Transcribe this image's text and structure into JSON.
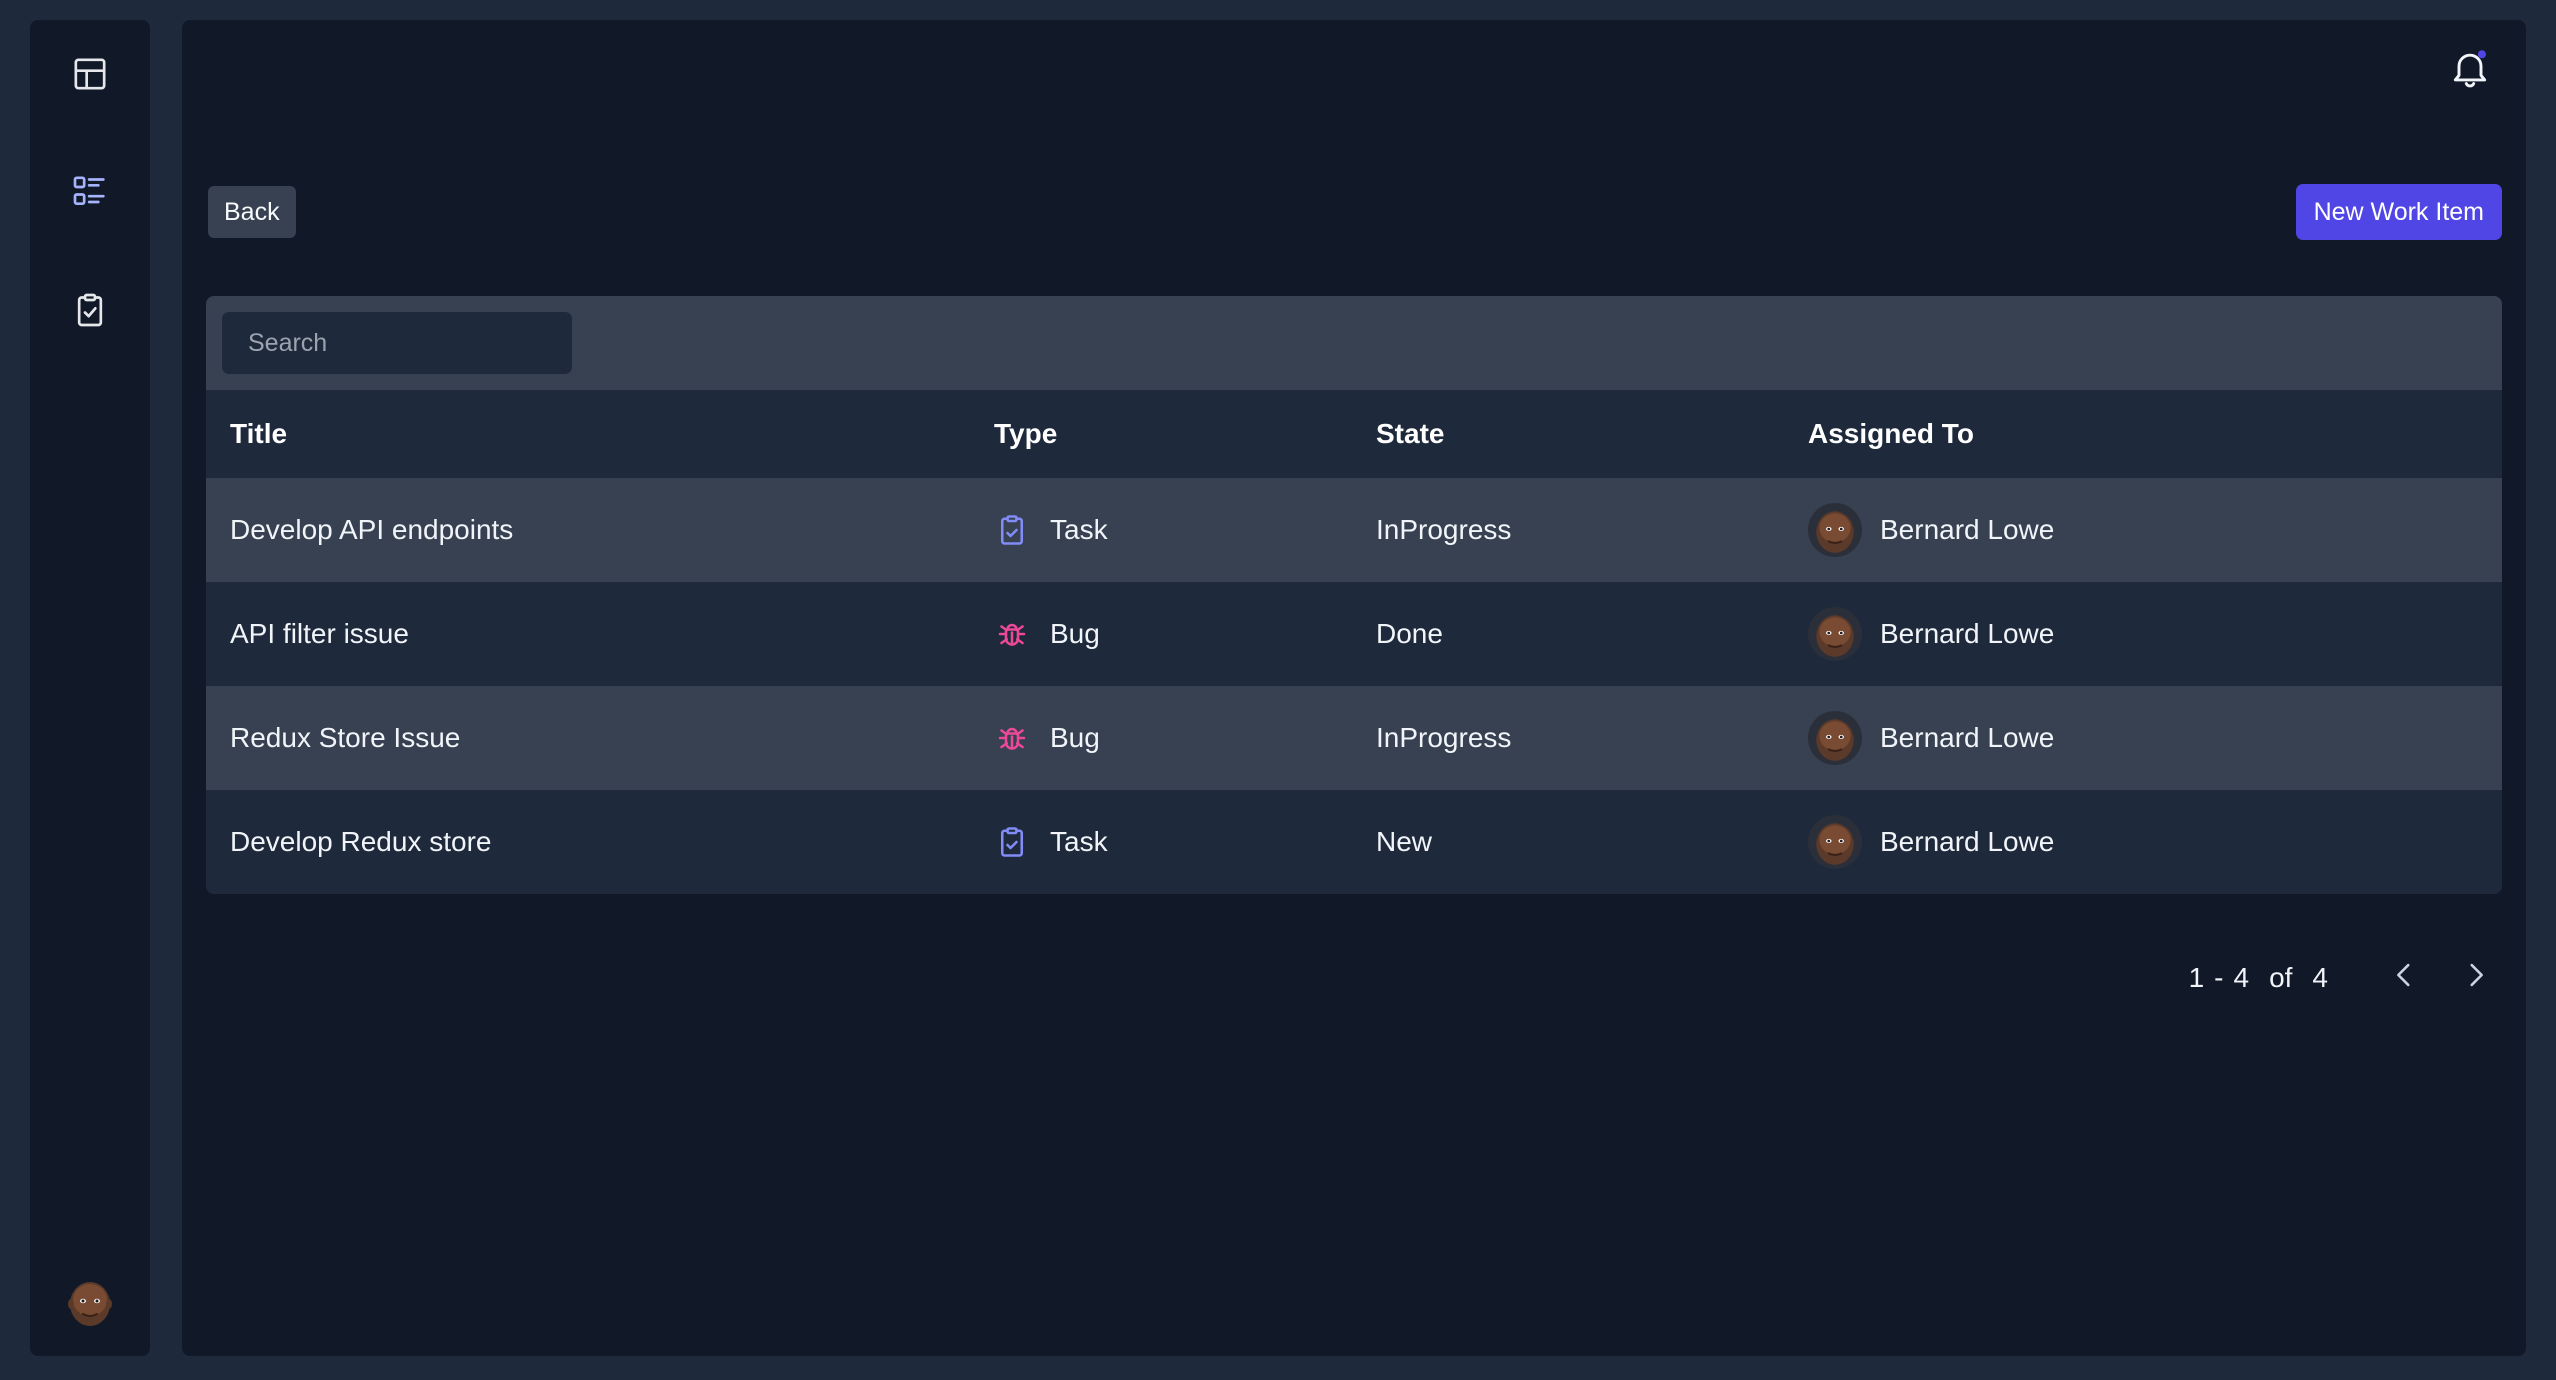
{
  "toolbar": {
    "back_label": "Back",
    "new_item_label": "New Work Item"
  },
  "search": {
    "placeholder": "Search",
    "value": ""
  },
  "table": {
    "columns": [
      "Title",
      "Type",
      "State",
      "Assigned To"
    ],
    "rows": [
      {
        "title": "Develop API endpoints",
        "type": "Task",
        "type_icon": "clipboard-check-icon",
        "state": "InProgress",
        "assignee": "Bernard Lowe"
      },
      {
        "title": "API filter issue",
        "type": "Bug",
        "type_icon": "bug-icon",
        "state": "Done",
        "assignee": "Bernard Lowe"
      },
      {
        "title": "Redux Store Issue",
        "type": "Bug",
        "type_icon": "bug-icon",
        "state": "InProgress",
        "assignee": "Bernard Lowe"
      },
      {
        "title": "Develop Redux store",
        "type": "Task",
        "type_icon": "clipboard-check-icon",
        "state": "New",
        "assignee": "Bernard Lowe"
      }
    ]
  },
  "pagination": {
    "start": "1",
    "dash": "-",
    "end": "4",
    "of_label": "of",
    "total": "4"
  },
  "sidebar": {
    "items": [
      {
        "icon": "layout-icon"
      },
      {
        "icon": "list-icon"
      },
      {
        "icon": "clipboard-check-icon"
      }
    ]
  },
  "colors": {
    "background": "#1e293b",
    "panel": "#111827",
    "accent": "#4f46e5",
    "task_icon": "#818cf8",
    "bug_icon": "#ec4899"
  }
}
